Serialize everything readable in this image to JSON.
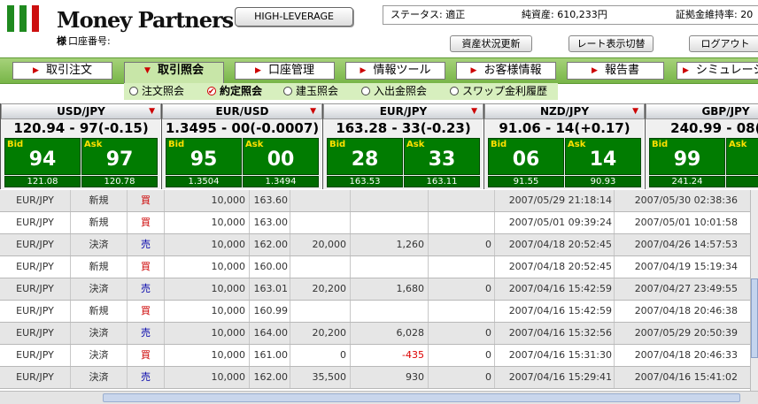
{
  "header": {
    "brand": "Money Partners",
    "account_prefix": "様",
    "account_label": "口座番号:",
    "high_leverage_button": "HIGH-LEVERAGE",
    "status_label": "ステータス: 適正",
    "net_assets": "純資産: 610,233円",
    "margin_rate": "証拠金維持率: 20",
    "asset_refresh_button": "資産状況更新",
    "rate_display_button": "レート表示切替",
    "logout_button": "ログアウト"
  },
  "nav": {
    "tabs": [
      {
        "label": "取引注文",
        "active": false
      },
      {
        "label": "取引照会",
        "active": true
      },
      {
        "label": "口座管理",
        "active": false
      },
      {
        "label": "情報ツール",
        "active": false
      },
      {
        "label": "お客様情報",
        "active": false
      },
      {
        "label": "報告書",
        "active": false
      },
      {
        "label": "シミュレーショ",
        "active": false
      }
    ],
    "subtabs": [
      {
        "label": "注文照会",
        "selected": false
      },
      {
        "label": "約定照会",
        "selected": true
      },
      {
        "label": "建玉照会",
        "selected": false
      },
      {
        "label": "入出金照会",
        "selected": false
      },
      {
        "label": "スワップ金利履歴",
        "selected": false
      }
    ]
  },
  "colors": {
    "accent_green": "#78b548",
    "rate_box": "#017c01",
    "buy": "#cc0000",
    "sell": "#0000aa"
  },
  "rates": [
    {
      "pair": "USD/JPY",
      "quote": "120.94 - 97(-0.15)",
      "bid_label": "Bid",
      "ask_label": "Ask",
      "bid": "94",
      "ask": "97",
      "bid_sub": "121.08",
      "ask_sub": "120.78"
    },
    {
      "pair": "EUR/USD",
      "quote": "1.3495 - 00(-0.0007)",
      "bid_label": "Bid",
      "ask_label": "Ask",
      "bid": "95",
      "ask": "00",
      "bid_sub": "1.3504",
      "ask_sub": "1.3494"
    },
    {
      "pair": "EUR/JPY",
      "quote": "163.28 - 33(-0.23)",
      "bid_label": "Bid",
      "ask_label": "Ask",
      "bid": "28",
      "ask": "33",
      "bid_sub": "163.53",
      "ask_sub": "163.11"
    },
    {
      "pair": "NZD/JPY",
      "quote": "91.06 - 14(+0.17)",
      "bid_label": "Bid",
      "ask_label": "Ask",
      "bid": "06",
      "ask": "14",
      "bid_sub": "91.55",
      "ask_sub": "90.93"
    },
    {
      "pair": "GBP/JPY",
      "quote": "240.99 - 08(-0.",
      "bid_label": "Bid",
      "ask_label": "Ask",
      "bid": "99",
      "ask": "0",
      "bid_sub": "241.24",
      "ask_sub": "2"
    }
  ],
  "trades": [
    {
      "pair": "EUR/JPY",
      "kind": "新規",
      "side": "買",
      "side_type": "buy",
      "qty": "10,000",
      "price": "163.60",
      "c5": "",
      "c6": "",
      "c7": "",
      "date1": "2007/05/29 21:18:14",
      "date2": "2007/05/30 02:38:36"
    },
    {
      "pair": "EUR/JPY",
      "kind": "新規",
      "side": "買",
      "side_type": "buy",
      "qty": "10,000",
      "price": "163.00",
      "c5": "",
      "c6": "",
      "c7": "",
      "date1": "2007/05/01 09:39:24",
      "date2": "2007/05/01 10:01:58"
    },
    {
      "pair": "EUR/JPY",
      "kind": "決済",
      "side": "売",
      "side_type": "sell",
      "qty": "10,000",
      "price": "162.00",
      "c5": "20,000",
      "c6": "1,260",
      "c7": "0",
      "date1": "2007/04/18 20:52:45",
      "date2": "2007/04/26 14:57:53"
    },
    {
      "pair": "EUR/JPY",
      "kind": "新規",
      "side": "買",
      "side_type": "buy",
      "qty": "10,000",
      "price": "160.00",
      "c5": "",
      "c6": "",
      "c7": "",
      "date1": "2007/04/18 20:52:45",
      "date2": "2007/04/19 15:19:34"
    },
    {
      "pair": "EUR/JPY",
      "kind": "決済",
      "side": "売",
      "side_type": "sell",
      "qty": "10,000",
      "price": "163.01",
      "c5": "20,200",
      "c6": "1,680",
      "c7": "0",
      "date1": "2007/04/16 15:42:59",
      "date2": "2007/04/27 23:49:55"
    },
    {
      "pair": "EUR/JPY",
      "kind": "新規",
      "side": "買",
      "side_type": "buy",
      "qty": "10,000",
      "price": "160.99",
      "c5": "",
      "c6": "",
      "c7": "",
      "date1": "2007/04/16 15:42:59",
      "date2": "2007/04/18 20:46:38"
    },
    {
      "pair": "EUR/JPY",
      "kind": "決済",
      "side": "売",
      "side_type": "sell",
      "qty": "10,000",
      "price": "164.00",
      "c5": "20,200",
      "c6": "6,028",
      "c7": "0",
      "date1": "2007/04/16 15:32:56",
      "date2": "2007/05/29 20:50:39"
    },
    {
      "pair": "EUR/JPY",
      "kind": "決済",
      "side": "買",
      "side_type": "buy",
      "qty": "10,000",
      "price": "161.00",
      "c5": "0",
      "c6": "-435",
      "c7": "0",
      "date1": "2007/04/16 15:31:30",
      "date2": "2007/04/18 20:46:33"
    },
    {
      "pair": "EUR/JPY",
      "kind": "決済",
      "side": "売",
      "side_type": "sell",
      "qty": "10,000",
      "price": "162.00",
      "c5": "35,500",
      "c6": "930",
      "c7": "0",
      "date1": "2007/04/16 15:29:41",
      "date2": "2007/04/16 15:41:02"
    }
  ]
}
